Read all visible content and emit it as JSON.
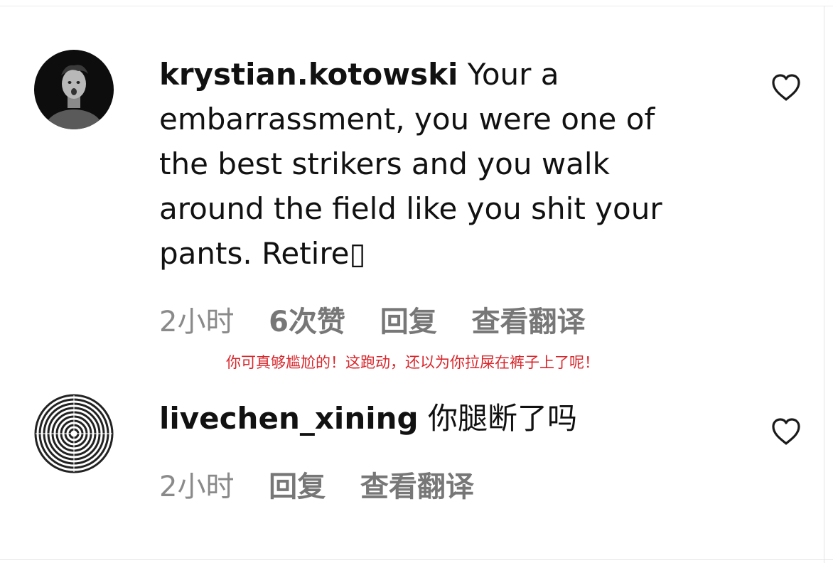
{
  "comments": [
    {
      "username": "krystian.kotowski",
      "text_lines": [
        "Your a",
        "embarrassment, you were one of",
        "the best strikers and you walk",
        "around the field like you shit your",
        "pants. Retire▯"
      ],
      "time": "2小时",
      "likes": "6次赞",
      "reply_label": "回复",
      "translate_label": "查看翻译"
    },
    {
      "username": "livechen_xining",
      "text": "你腿断了吗",
      "time": "2小时",
      "reply_label": "回复",
      "translate_label": "查看翻译"
    }
  ],
  "annotation": "你可真够尴尬的！这跑动，还以为你拉屎在裤子上了呢！",
  "icons": {
    "like": "heart-outline-icon"
  },
  "colors": {
    "annotation": "#d9262b",
    "meta": "#8a8a8a"
  }
}
